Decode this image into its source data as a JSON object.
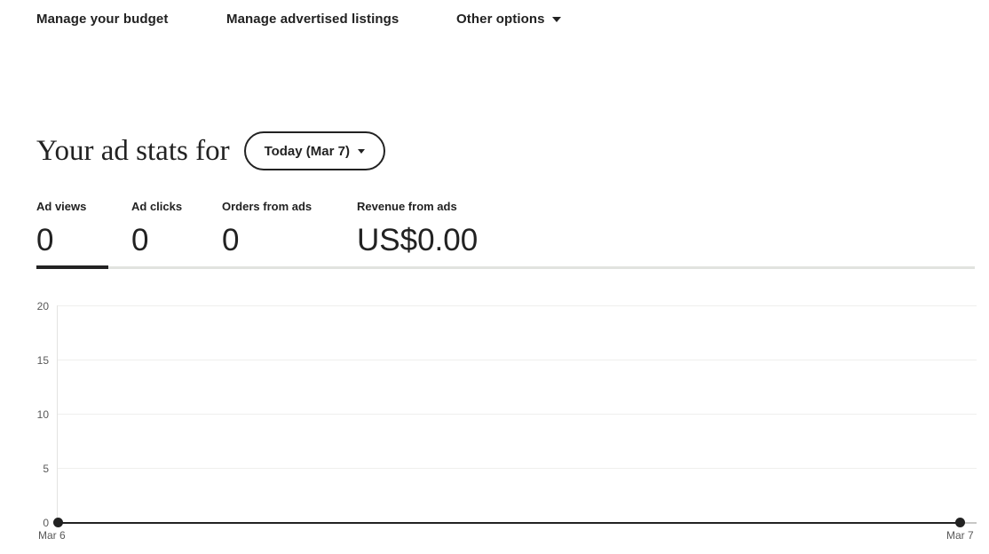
{
  "nav": {
    "items": [
      {
        "label": "Manage your budget",
        "has_caret": false
      },
      {
        "label": "Manage advertised listings",
        "has_caret": false
      },
      {
        "label": "Other options",
        "has_caret": true,
        "icon": "chevron-down-icon"
      }
    ]
  },
  "header": {
    "title": "Your ad stats for",
    "range_selector": {
      "label": "Today (Mar 7)",
      "icon": "chevron-down-icon"
    }
  },
  "stats": [
    {
      "label": "Ad views",
      "value": "0",
      "selected": true
    },
    {
      "label": "Ad clicks",
      "value": "0",
      "selected": false
    },
    {
      "label": "Orders from ads",
      "value": "0",
      "selected": false
    },
    {
      "label": "Revenue from ads",
      "value": "US$0.00",
      "selected": false
    }
  ],
  "chart_data": {
    "type": "line",
    "title": "",
    "xlabel": "",
    "ylabel": "",
    "x": [
      "Mar 6",
      "Mar 7"
    ],
    "series": [
      {
        "name": "Ad views",
        "values": [
          0,
          0
        ]
      }
    ],
    "categories": [
      "Mar 6",
      "Mar 7"
    ],
    "values": [
      0,
      0
    ],
    "yticks": [
      "0",
      "5",
      "10",
      "15",
      "20"
    ],
    "ylim": [
      0,
      20
    ],
    "xticks": [
      "Mar 6",
      "Mar 7"
    ],
    "grid": true,
    "legend": false,
    "line_color": "#222222",
    "grid_color": "#efefed"
  },
  "colors": {
    "text": "#222222",
    "muted": "#595959",
    "divider": "#e1e3df",
    "accent": "#222222"
  }
}
